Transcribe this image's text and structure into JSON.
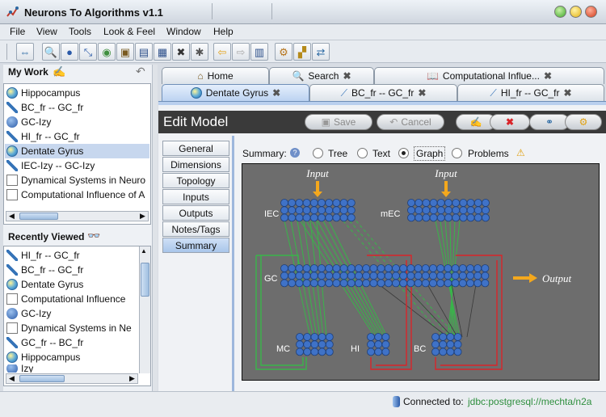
{
  "window": {
    "title": "Neurons To Algorithms v1.1"
  },
  "menu": [
    "File",
    "View",
    "Tools",
    "Look & Feel",
    "Window",
    "Help"
  ],
  "my_work": {
    "title": "My Work",
    "items": [
      "Hippocampus",
      "BC_fr -- GC_fr",
      "GC-Izy",
      "HI_fr -- GC_fr",
      "Dentate Gyrus",
      "IEC-Izy -- GC-Izy",
      "Dynamical Systems in Neuro",
      "Computational Influence of A"
    ]
  },
  "recent": {
    "title": "Recently Viewed",
    "items": [
      "HI_fr -- GC_fr",
      "BC_fr -- GC_fr",
      "Dentate Gyrus",
      "Computational Influence",
      "GC-Izy",
      "Dynamical Systems in Ne",
      "GC_fr -- BC_fr",
      "Hippocampus",
      "Izy"
    ]
  },
  "tabs_top": [
    "Home",
    "Search",
    "Computational Influe..."
  ],
  "tabs_bottom": [
    "Dentate Gyrus",
    "BC_fr -- GC_fr",
    "HI_fr -- GC_fr"
  ],
  "edit": {
    "title": "Edit Model",
    "save": "Save",
    "cancel": "Cancel"
  },
  "side_tabs": [
    "General",
    "Dimensions",
    "Topology",
    "Inputs",
    "Outputs",
    "Notes/Tags",
    "Summary"
  ],
  "summary": {
    "label": "Summary:",
    "options": [
      "Tree",
      "Text",
      "Graph",
      "Problems"
    ],
    "selected": "Graph"
  },
  "graph": {
    "input_label": "Input",
    "output_label": "Output",
    "populations": [
      "IEC",
      "mEC",
      "GC",
      "MC",
      "HI",
      "BC"
    ],
    "colors": {
      "background": "#6d6d6d",
      "neuron": "#3f72c7",
      "excitatory": "#39b54a",
      "inhibitory": "#d9252a",
      "arrow": "#f4a81d"
    }
  },
  "status": {
    "label": "Connected to:",
    "value": "jdbc:postgresql://mechta/n2a"
  }
}
